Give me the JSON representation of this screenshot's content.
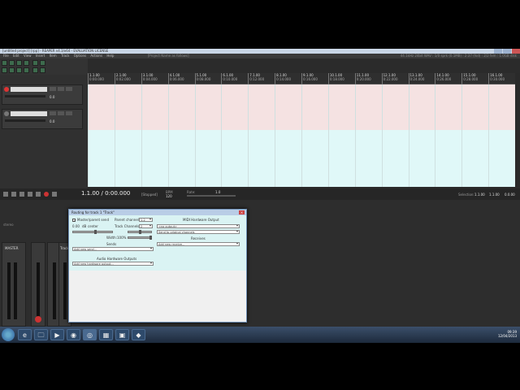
{
  "window": {
    "title": "[untitled project] [rpp] - REAPER v4.3/x64 - EVALUATION LICENSE",
    "status_right": "44.1kHz 24bit WAV : 1/0 sprk (0.1MB) : 2:37 (fsd) : 2/2 fxm : 1.0GB disk"
  },
  "menu": [
    "File",
    "Edit",
    "View",
    "Insert",
    "Item",
    "Track",
    "Options",
    "Actions",
    "Help"
  ],
  "menu_right": "[Project Name as follows]",
  "tracks": [
    {
      "name": "",
      "db": "0.0"
    },
    {
      "name": "",
      "db": "0.0"
    },
    {
      "name": "Track",
      "db": "0.0"
    }
  ],
  "ruler": [
    {
      "bar": "1.1.00",
      "time": "0:00.000"
    },
    {
      "bar": "2.1.00",
      "time": "0:02.000"
    },
    {
      "bar": "3.1.00",
      "time": "0:04.000"
    },
    {
      "bar": "4.1.00",
      "time": "0:06.000"
    },
    {
      "bar": "5.1.00",
      "time": "0:08.000"
    },
    {
      "bar": "6.1.00",
      "time": "0:10.000"
    },
    {
      "bar": "7.1.00",
      "time": "0:12.000"
    },
    {
      "bar": "8.1.00",
      "time": "0:14.000"
    },
    {
      "bar": "9.1.00",
      "time": "0:16.000"
    },
    {
      "bar": "10.1.00",
      "time": "0:18.000"
    },
    {
      "bar": "11.1.00",
      "time": "0:20.000"
    },
    {
      "bar": "12.1.00",
      "time": "0:22.000"
    },
    {
      "bar": "13.1.00",
      "time": "0:24.000"
    },
    {
      "bar": "14.1.00",
      "time": "0:26.000"
    },
    {
      "bar": "15.1.00",
      "time": "0:28.000"
    },
    {
      "bar": "16.1.00",
      "time": "0:30.000"
    }
  ],
  "transport": {
    "position": "1.1.00 / 0:00.000",
    "state": "[Stopped]",
    "bpm_label": "BPM",
    "bpm": "120",
    "rate_label": "Rate:",
    "rate": "1.0",
    "selection_label": "Selection:",
    "sel_start": "1.1.00",
    "sel_end": "1.1.00",
    "sel_len": "0.0.00"
  },
  "dialog": {
    "title": "Routing for track 1 \"Track\"",
    "close": "×",
    "master_send": "Master/parent send",
    "parent_channels_label": "Parent channels:",
    "parent_channels": "1-2",
    "track_channels_label": "Track Channels:",
    "track_channels": "2",
    "pan_value": "0.00",
    "pan_db": "dB",
    "pan_center": "center",
    "width_label": "Width:",
    "width_value": "100%",
    "midi_output_header": "MIDI Hardware Output",
    "midi_output_value": "<no output>",
    "midi_send_value": "Send to original channels",
    "sends_header": "Sends",
    "add_send": "Add new send...",
    "receives_header": "Receives",
    "add_receive": "Add new receive...",
    "hw_outputs_header": "Audio Hardware Outputs",
    "add_hw_output": "Add new hardware output..."
  },
  "mixer": {
    "master_label": "MASTER",
    "track_label": "Track",
    "mode": "stereo"
  },
  "taskbar": {
    "apps": [
      "e",
      "🗀",
      "▶",
      "◉",
      "◎",
      "▦",
      "▣",
      "◆"
    ],
    "time": "09:39",
    "date": "12/04/2013"
  },
  "colors": {
    "track1": "#f5e2e2",
    "track2": "#e0f8f8",
    "arrange_bg": "#e4fbfb",
    "dialog_body": "#daf3f3",
    "record": "#dd3333"
  }
}
